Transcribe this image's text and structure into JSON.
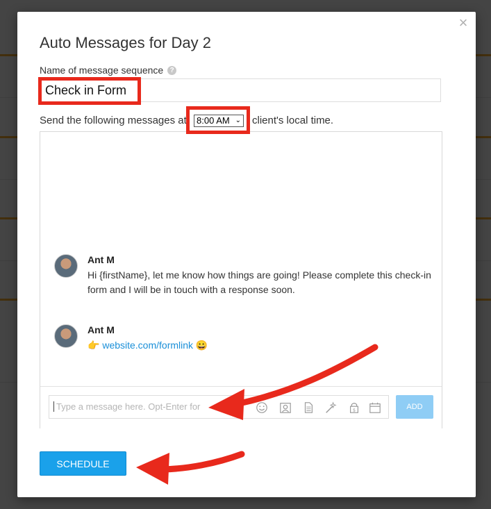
{
  "modal": {
    "title": "Auto Messages for Day 2",
    "name_label": "Name of message sequence",
    "help_icon": "?",
    "close_icon": "×",
    "name_value": "Check in Form",
    "send_prefix": "Send the following messages at",
    "send_time": "8:00 AM",
    "send_suffix": "client's local time."
  },
  "messages": [
    {
      "author": "Ant M",
      "text": "Hi {firstName}, let me know how things are going! Please complete this check-in form and I will be in touch with a response soon."
    },
    {
      "author": "Ant M",
      "emoji_before": "👉",
      "link": "website.com/formlink",
      "emoji_after": "😀"
    }
  ],
  "composer": {
    "placeholder": "Type a message here. Opt-Enter for",
    "add_label": "ADD",
    "icons": [
      "smiley-icon",
      "contact-card-icon",
      "document-icon",
      "magic-wand-icon",
      "paid-lock-icon",
      "calendar-icon"
    ]
  },
  "actions": {
    "schedule_label": "SCHEDULE"
  },
  "colors": {
    "highlight_red": "#e8291c",
    "primary_blue": "#1aa1ea",
    "link_blue": "#1a8fd8"
  }
}
